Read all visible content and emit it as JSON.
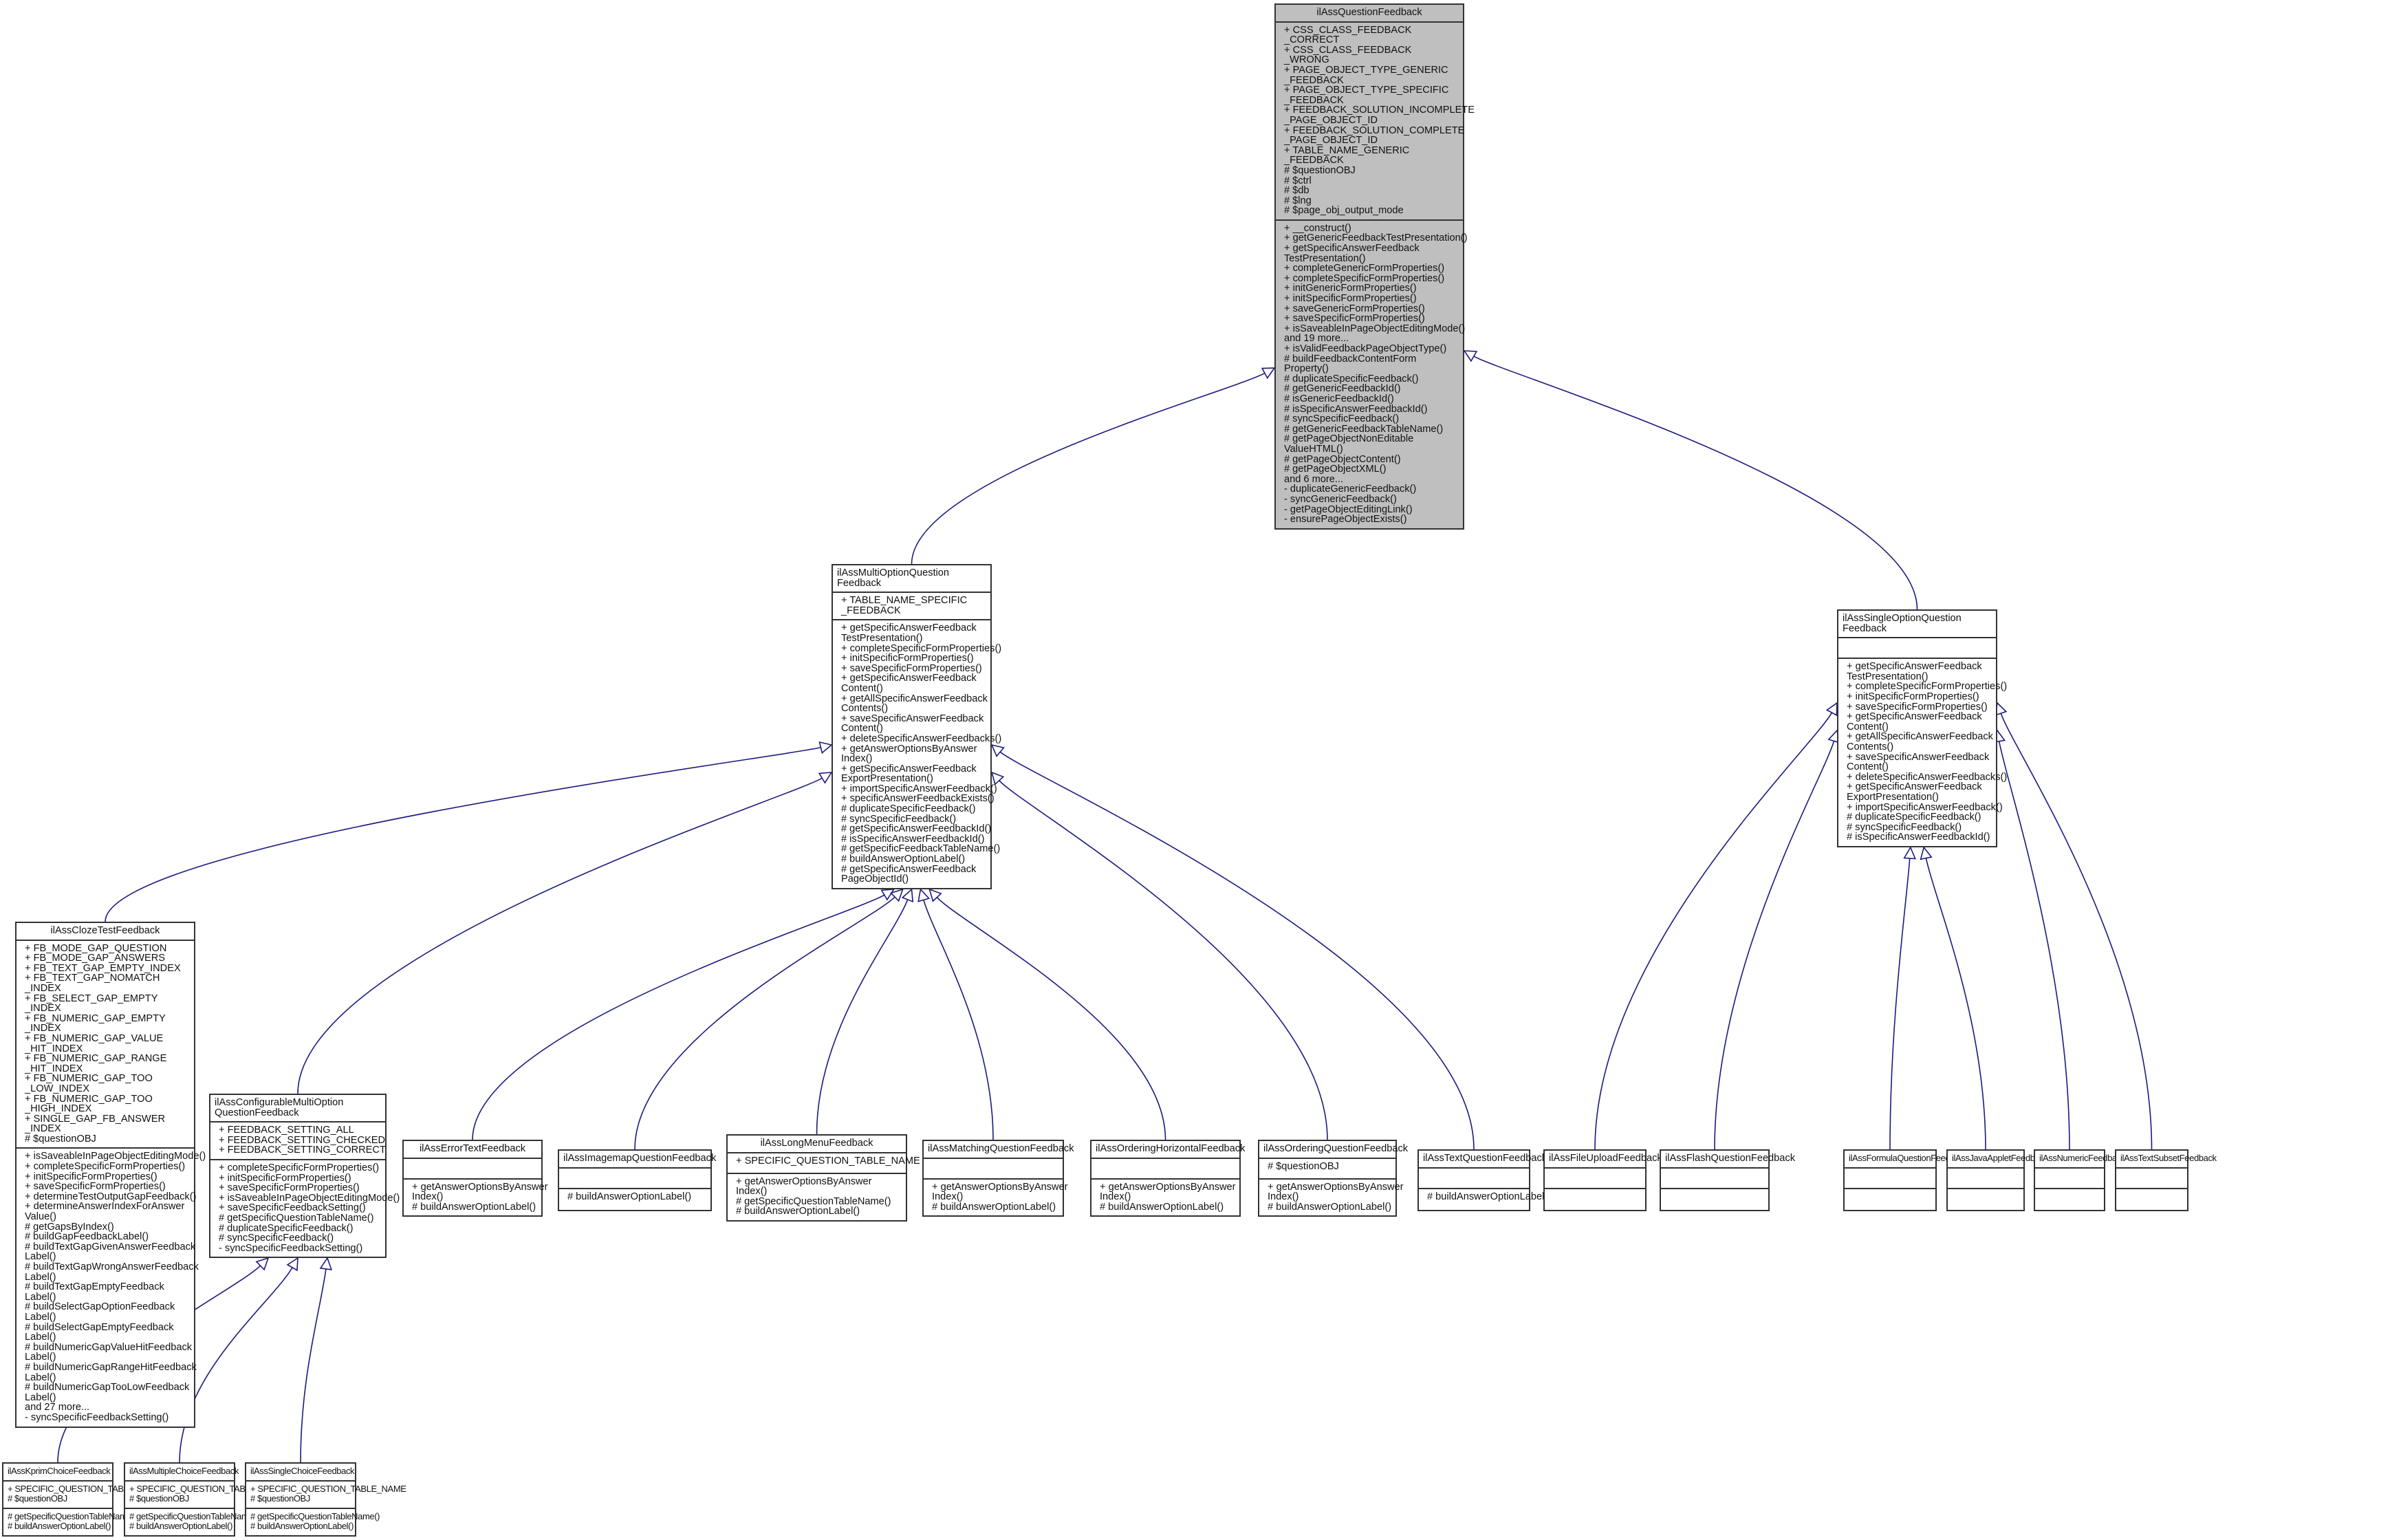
{
  "diagram": {
    "type": "class-inheritance",
    "edge_color": "#1a1a80",
    "base_fill": "#bfbfbf",
    "classes": [
      {
        "id": "ilAssQuestionFeedback",
        "title": "ilAssQuestionFeedback",
        "attributes": [
          "+ CSS_CLASS_FEEDBACK",
          "_CORRECT",
          "+ CSS_CLASS_FEEDBACK",
          "_WRONG",
          "+ PAGE_OBJECT_TYPE_GENERIC",
          "_FEEDBACK",
          "+ PAGE_OBJECT_TYPE_SPECIFIC",
          "_FEEDBACK",
          "+ FEEDBACK_SOLUTION_INCOMPLETE",
          "_PAGE_OBJECT_ID",
          "+ FEEDBACK_SOLUTION_COMPLETE",
          "_PAGE_OBJECT_ID",
          "+ TABLE_NAME_GENERIC",
          "_FEEDBACK",
          "# $questionOBJ",
          "# $ctrl",
          "# $db",
          "# $lng",
          "# $page_obj_output_mode"
        ],
        "methods": [
          "+ __construct()",
          "+ getGenericFeedbackTestPresentation()",
          "+ getSpecificAnswerFeedback",
          "TestPresentation()",
          "+ completeGenericFormProperties()",
          "+ completeSpecificFormProperties()",
          "+ initGenericFormProperties()",
          "+ initSpecificFormProperties()",
          "+ saveGenericFormProperties()",
          "+ saveSpecificFormProperties()",
          "+ isSaveableInPageObjectEditingMode()",
          "and 19 more...",
          "+ isValidFeedbackPageObjectType()",
          "# buildFeedbackContentForm",
          "Property()",
          "# duplicateSpecificFeedback()",
          "# getGenericFeedbackId()",
          "# isGenericFeedbackId()",
          "# isSpecificAnswerFeedbackId()",
          "# syncSpecificFeedback()",
          "# getGenericFeedbackTableName()",
          "# getPageObjectNonEditable",
          "ValueHTML()",
          "# getPageObjectContent()",
          "# getPageObjectXML()",
          "and 6 more...",
          "- duplicateGenericFeedback()",
          "- syncGenericFeedback()",
          "- getPageObjectEditingLink()",
          "- ensurePageObjectExists()"
        ]
      },
      {
        "id": "ilAssMultiOptionQuestionFeedback",
        "title": "ilAssMultiOptionQuestion\n          Feedback",
        "attributes": [
          "+ TABLE_NAME_SPECIFIC",
          "_FEEDBACK"
        ],
        "methods": [
          "+ getSpecificAnswerFeedback",
          "TestPresentation()",
          "+ completeSpecificFormProperties()",
          "+ initSpecificFormProperties()",
          "+ saveSpecificFormProperties()",
          "+ getSpecificAnswerFeedback",
          "Content()",
          "+ getAllSpecificAnswerFeedback",
          "Contents()",
          "+ saveSpecificAnswerFeedback",
          "Content()",
          "+ deleteSpecificAnswerFeedbacks()",
          "+ getAnswerOptionsByAnswer",
          "Index()",
          "+ getSpecificAnswerFeedback",
          "ExportPresentation()",
          "+ importSpecificAnswerFeedback()",
          "+ specificAnswerFeedbackExists()",
          "# duplicateSpecificFeedback()",
          "# syncSpecificFeedback()",
          "# getSpecificAnswerFeedbackId()",
          "# isSpecificAnswerFeedbackId()",
          "# getSpecificFeedbackTableName()",
          "# buildAnswerOptionLabel()",
          "# getSpecificAnswerFeedback",
          "PageObjectId()"
        ]
      },
      {
        "id": "ilAssSingleOptionQuestionFeedback",
        "title": "ilAssSingleOptionQuestion\n          Feedback",
        "attributes": [],
        "methods": [
          "+ getSpecificAnswerFeedback",
          "TestPresentation()",
          "+ completeSpecificFormProperties()",
          "+ initSpecificFormProperties()",
          "+ saveSpecificFormProperties()",
          "+ getSpecificAnswerFeedback",
          "Content()",
          "+ getAllSpecificAnswerFeedback",
          "Contents()",
          "+ saveSpecificAnswerFeedback",
          "Content()",
          "+ deleteSpecificAnswerFeedbacks()",
          "+ getSpecificAnswerFeedback",
          "ExportPresentation()",
          "+ importSpecificAnswerFeedback()",
          "# duplicateSpecificFeedback()",
          "# syncSpecificFeedback()",
          "# isSpecificAnswerFeedbackId()"
        ]
      },
      {
        "id": "ilAssClozeTestFeedback",
        "title": "ilAssClozeTestFeedback",
        "attributes": [
          "+ FB_MODE_GAP_QUESTION",
          "+ FB_MODE_GAP_ANSWERS",
          "+ FB_TEXT_GAP_EMPTY_INDEX",
          "+ FB_TEXT_GAP_NOMATCH",
          "_INDEX",
          "+ FB_SELECT_GAP_EMPTY",
          "_INDEX",
          "+ FB_NUMERIC_GAP_EMPTY",
          "_INDEX",
          "+ FB_NUMERIC_GAP_VALUE",
          "_HIT_INDEX",
          "+ FB_NUMERIC_GAP_RANGE",
          "_HIT_INDEX",
          "+ FB_NUMERIC_GAP_TOO",
          "_LOW_INDEX",
          "+ FB_NUMERIC_GAP_TOO",
          "_HIGH_INDEX",
          "+ SINGLE_GAP_FB_ANSWER",
          "_INDEX",
          "# $questionOBJ"
        ],
        "methods": [
          "+ isSaveableInPageObjectEditingMode()",
          "+ completeSpecificFormProperties()",
          "+ initSpecificFormProperties()",
          "+ saveSpecificFormProperties()",
          "+ determineTestOutputGapFeedback()",
          "+ determineAnswerIndexForAnswer",
          "Value()",
          "# getGapsByIndex()",
          "# buildGapFeedbackLabel()",
          "# buildTextGapGivenAnswerFeedback",
          "Label()",
          "# buildTextGapWrongAnswerFeedback",
          "Label()",
          "# buildTextGapEmptyFeedback",
          "Label()",
          "# buildSelectGapOptionFeedback",
          "Label()",
          "# buildSelectGapEmptyFeedback",
          "Label()",
          "# buildNumericGapValueHitFeedback",
          "Label()",
          "# buildNumericGapRangeHitFeedback",
          "Label()",
          "# buildNumericGapTooLowFeedback",
          "Label()",
          "and 27 more...",
          "- syncSpecificFeedbackSetting()"
        ]
      },
      {
        "id": "ilAssConfigurableMultiOptionQuestionFeedback",
        "title": "ilAssConfigurableMultiOption\n        QuestionFeedback",
        "attributes": [
          "+ FEEDBACK_SETTING_ALL",
          "+ FEEDBACK_SETTING_CHECKED",
          "+ FEEDBACK_SETTING_CORRECT"
        ],
        "methods": [
          "+ completeSpecificFormProperties()",
          "+ initSpecificFormProperties()",
          "+ saveSpecificFormProperties()",
          "+ isSaveableInPageObjectEditingMode()",
          "+ saveSpecificFeedbackSetting()",
          "# getSpecificQuestionTableName()",
          "# duplicateSpecificFeedback()",
          "# syncSpecificFeedback()",
          "- syncSpecificFeedbackSetting()"
        ]
      },
      {
        "id": "ilAssErrorTextFeedback",
        "title": "ilAssErrorTextFeedback",
        "attributes": [],
        "methods": [
          "+ getAnswerOptionsByAnswer",
          "Index()",
          "# buildAnswerOptionLabel()"
        ]
      },
      {
        "id": "ilAssImagemapQuestionFeedback",
        "title": "ilAssImagemapQuestionFeedback",
        "attributes": [],
        "methods": [
          "# buildAnswerOptionLabel()"
        ]
      },
      {
        "id": "ilAssLongMenuFeedback",
        "title": "ilAssLongMenuFeedback",
        "attributes": [
          "+ SPECIFIC_QUESTION_TABLE_NAME"
        ],
        "methods": [
          "+ getAnswerOptionsByAnswer",
          "Index()",
          "# getSpecificQuestionTableName()",
          "# buildAnswerOptionLabel()"
        ]
      },
      {
        "id": "ilAssMatchingQuestionFeedback",
        "title": "ilAssMatchingQuestionFeedback",
        "attributes": [],
        "methods": [
          "+ getAnswerOptionsByAnswer",
          "Index()",
          "# buildAnswerOptionLabel()"
        ]
      },
      {
        "id": "ilAssOrderingHorizontalFeedback",
        "title": "ilAssOrderingHorizontalFeedback",
        "attributes": [],
        "methods": [
          "+ getAnswerOptionsByAnswer",
          "Index()",
          "# buildAnswerOptionLabel()"
        ]
      },
      {
        "id": "ilAssOrderingQuestionFeedback",
        "title": "ilAssOrderingQuestionFeedback",
        "attributes": [
          "# $questionOBJ"
        ],
        "methods": [
          "+ getAnswerOptionsByAnswer",
          "Index()",
          "# buildAnswerOptionLabel()"
        ]
      },
      {
        "id": "ilAssTextQuestionFeedback",
        "title": "ilAssTextQuestionFeedback",
        "attributes": [],
        "methods": [
          "# buildAnswerOptionLabel()"
        ]
      },
      {
        "id": "ilAssFileUploadFeedback",
        "title": "ilAssFileUploadFeedback",
        "attributes": [],
        "methods": []
      },
      {
        "id": "ilAssFlashQuestionFeedback",
        "title": "ilAssFlashQuestionFeedback",
        "attributes": [],
        "methods": []
      },
      {
        "id": "ilAssFormulaQuestionFeedback",
        "title": "ilAssFormulaQuestionFeedback",
        "attributes": [],
        "methods": []
      },
      {
        "id": "ilAssJavaAppletFeedback",
        "title": "ilAssJavaAppletFeedback",
        "attributes": [],
        "methods": []
      },
      {
        "id": "ilAssNumericFeedback",
        "title": "ilAssNumericFeedback",
        "attributes": [],
        "methods": []
      },
      {
        "id": "ilAssTextSubsetFeedback",
        "title": "ilAssTextSubsetFeedback",
        "attributes": [],
        "methods": []
      },
      {
        "id": "ilAssKprimChoiceFeedback",
        "title": "ilAssKprimChoiceFeedback",
        "attributes": [
          "+ SPECIFIC_QUESTION_TABLE_NAME",
          "# $questionOBJ"
        ],
        "methods": [
          "# getSpecificQuestionTableName()",
          "# buildAnswerOptionLabel()"
        ]
      },
      {
        "id": "ilAssMultipleChoiceFeedback",
        "title": "ilAssMultipleChoiceFeedback",
        "attributes": [
          "+ SPECIFIC_QUESTION_TABLE_NAME",
          "# $questionOBJ"
        ],
        "methods": [
          "# getSpecificQuestionTableName()",
          "# buildAnswerOptionLabel()"
        ]
      },
      {
        "id": "ilAssSingleChoiceFeedback",
        "title": "ilAssSingleChoiceFeedback",
        "attributes": [
          "+ SPECIFIC_QUESTION_TABLE_NAME",
          "# $questionOBJ"
        ],
        "methods": [
          "# getSpecificQuestionTableName()",
          "# buildAnswerOptionLabel()"
        ]
      }
    ],
    "inheritance": [
      {
        "child": "ilAssMultiOptionQuestionFeedback",
        "parent": "ilAssQuestionFeedback"
      },
      {
        "child": "ilAssSingleOptionQuestionFeedback",
        "parent": "ilAssQuestionFeedback"
      },
      {
        "child": "ilAssClozeTestFeedback",
        "parent": "ilAssMultiOptionQuestionFeedback"
      },
      {
        "child": "ilAssConfigurableMultiOptionQuestionFeedback",
        "parent": "ilAssMultiOptionQuestionFeedback"
      },
      {
        "child": "ilAssErrorTextFeedback",
        "parent": "ilAssMultiOptionQuestionFeedback"
      },
      {
        "child": "ilAssImagemapQuestionFeedback",
        "parent": "ilAssMultiOptionQuestionFeedback"
      },
      {
        "child": "ilAssLongMenuFeedback",
        "parent": "ilAssMultiOptionQuestionFeedback"
      },
      {
        "child": "ilAssMatchingQuestionFeedback",
        "parent": "ilAssMultiOptionQuestionFeedback"
      },
      {
        "child": "ilAssOrderingHorizontalFeedback",
        "parent": "ilAssMultiOptionQuestionFeedback"
      },
      {
        "child": "ilAssOrderingQuestionFeedback",
        "parent": "ilAssMultiOptionQuestionFeedback"
      },
      {
        "child": "ilAssTextQuestionFeedback",
        "parent": "ilAssMultiOptionQuestionFeedback"
      },
      {
        "child": "ilAssFileUploadFeedback",
        "parent": "ilAssSingleOptionQuestionFeedback"
      },
      {
        "child": "ilAssFlashQuestionFeedback",
        "parent": "ilAssSingleOptionQuestionFeedback"
      },
      {
        "child": "ilAssFormulaQuestionFeedback",
        "parent": "ilAssSingleOptionQuestionFeedback"
      },
      {
        "child": "ilAssJavaAppletFeedback",
        "parent": "ilAssSingleOptionQuestionFeedback"
      },
      {
        "child": "ilAssNumericFeedback",
        "parent": "ilAssSingleOptionQuestionFeedback"
      },
      {
        "child": "ilAssTextSubsetFeedback",
        "parent": "ilAssSingleOptionQuestionFeedback"
      },
      {
        "child": "ilAssKprimChoiceFeedback",
        "parent": "ilAssConfigurableMultiOptionQuestionFeedback"
      },
      {
        "child": "ilAssMultipleChoiceFeedback",
        "parent": "ilAssConfigurableMultiOptionQuestionFeedback"
      },
      {
        "child": "ilAssSingleChoiceFeedback",
        "parent": "ilAssConfigurableMultiOptionQuestionFeedback"
      }
    ]
  }
}
